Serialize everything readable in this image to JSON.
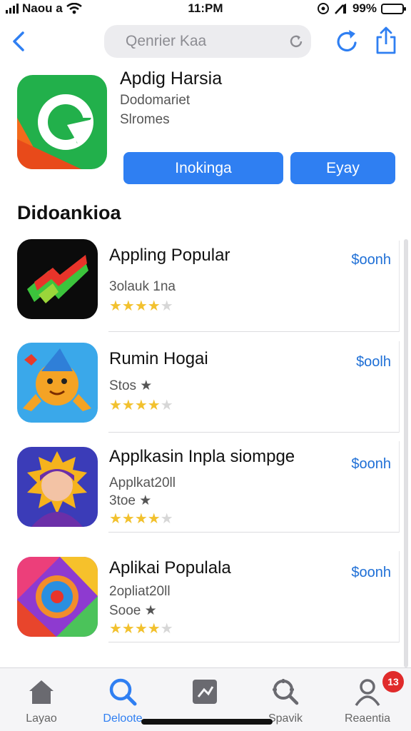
{
  "status_bar": {
    "carrier": "Naou a",
    "time": "11:PM",
    "battery": "99%",
    "battery_level": 0.9
  },
  "nav": {
    "back_icon": "chevron-left-icon",
    "search_placeholder": "Qenrier Kaa",
    "reload_icon": "reload-icon",
    "refresh_icon": "refresh-icon",
    "share_icon": "share-icon"
  },
  "featured": {
    "title": "Apdig Harsia",
    "developer": "Dodomariet",
    "category": "Slromes",
    "primary_button": "Inokinga",
    "secondary_button": "Eyay"
  },
  "section_title": "Didoankioa",
  "apps": [
    {
      "name": "Appling Popular",
      "price": "$oonh",
      "lines": [
        "3olauk 1na"
      ],
      "rating": 4.5
    },
    {
      "name": "Rumin Hogai",
      "price": "$oolh",
      "lines": [
        "Stos ★"
      ],
      "rating": 4.5
    },
    {
      "name": "Applkasin Inpla siompge",
      "price": "$oonh",
      "lines": [
        "Applkat20ll",
        "3toe ★"
      ],
      "rating": 4.5
    },
    {
      "name": "Aplikai Populala",
      "price": "$oonh",
      "lines": [
        "2opliat20ll",
        "Sooe ★"
      ],
      "rating": 4.5
    }
  ],
  "tabs": [
    {
      "label": "Layao",
      "icon": "home-icon",
      "active": false
    },
    {
      "label": "Deloote",
      "icon": "search-icon",
      "active": true
    },
    {
      "label": "",
      "icon": "games-icon",
      "active": false
    },
    {
      "label": "Spavik",
      "icon": "discover-icon",
      "active": false
    },
    {
      "label": "Reaentia",
      "icon": "profile-icon",
      "active": false
    }
  ],
  "badge_count": "13",
  "colors": {
    "accent": "#2f7ff2",
    "price": "#1e6fd6",
    "star": "#f2c12e",
    "badge": "#e02b2b"
  }
}
